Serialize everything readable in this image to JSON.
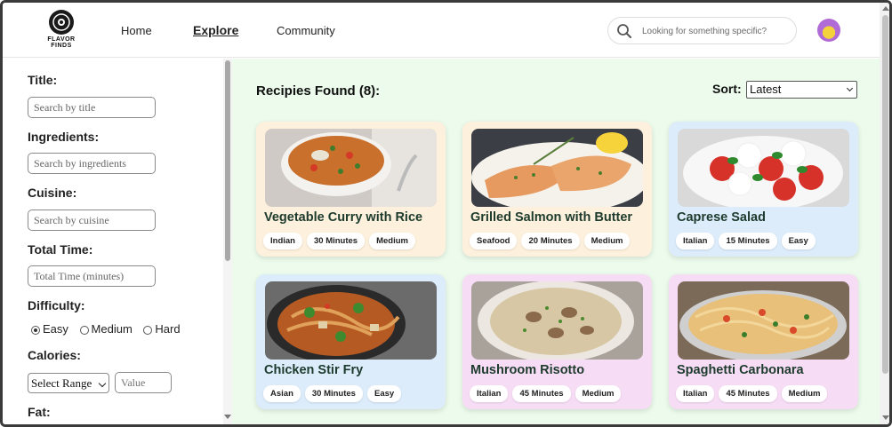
{
  "header": {
    "logo_text": "FLAVOR FINDS",
    "nav": [
      {
        "label": "Home"
      },
      {
        "label": "Explore"
      },
      {
        "label": "Community"
      }
    ],
    "search_placeholder": "Looking for something specific?"
  },
  "sidebar": {
    "title_label": "Title:",
    "title_placeholder": "Search by title",
    "ingredients_label": "Ingredients:",
    "ingredients_placeholder": "Search by ingredients",
    "cuisine_label": "Cuisine:",
    "cuisine_placeholder": "Search by cuisine",
    "total_time_label": "Total Time:",
    "total_time_placeholder": "Total Time (minutes)",
    "difficulty_label": "Difficulty:",
    "difficulty_options": [
      "Easy",
      "Medium",
      "Hard"
    ],
    "difficulty_selected": "Easy",
    "calories_label": "Calories:",
    "calories_range": "Select Range",
    "calories_value_placeholder": "Value",
    "fat_label": "Fat:"
  },
  "main": {
    "results_title": "Recipies Found (8):",
    "sort_label": "Sort:",
    "sort_value": "Latest",
    "recipes": [
      {
        "title": "Vegetable Curry with Rice",
        "tags": [
          "Indian",
          "30 Minutes",
          "Medium"
        ],
        "bg": "#fdf0dc"
      },
      {
        "title": "Grilled Salmon with Butter",
        "tags": [
          "Seafood",
          "20 Minutes",
          "Medium"
        ],
        "bg": "#fdf0dc"
      },
      {
        "title": "Caprese Salad",
        "tags": [
          "Italian",
          "15 Minutes",
          "Easy"
        ],
        "bg": "#dcecfb"
      },
      {
        "title": "Chicken Stir Fry",
        "tags": [
          "Asian",
          "30 Minutes",
          "Easy"
        ],
        "bg": "#dcecfb"
      },
      {
        "title": "Mushroom Risotto",
        "tags": [
          "Italian",
          "45 Minutes",
          "Medium"
        ],
        "bg": "#f7dcf5"
      },
      {
        "title": "Spaghetti Carbonara",
        "tags": [
          "Italian",
          "45 Minutes",
          "Medium"
        ],
        "bg": "#f7dcf5"
      }
    ]
  }
}
